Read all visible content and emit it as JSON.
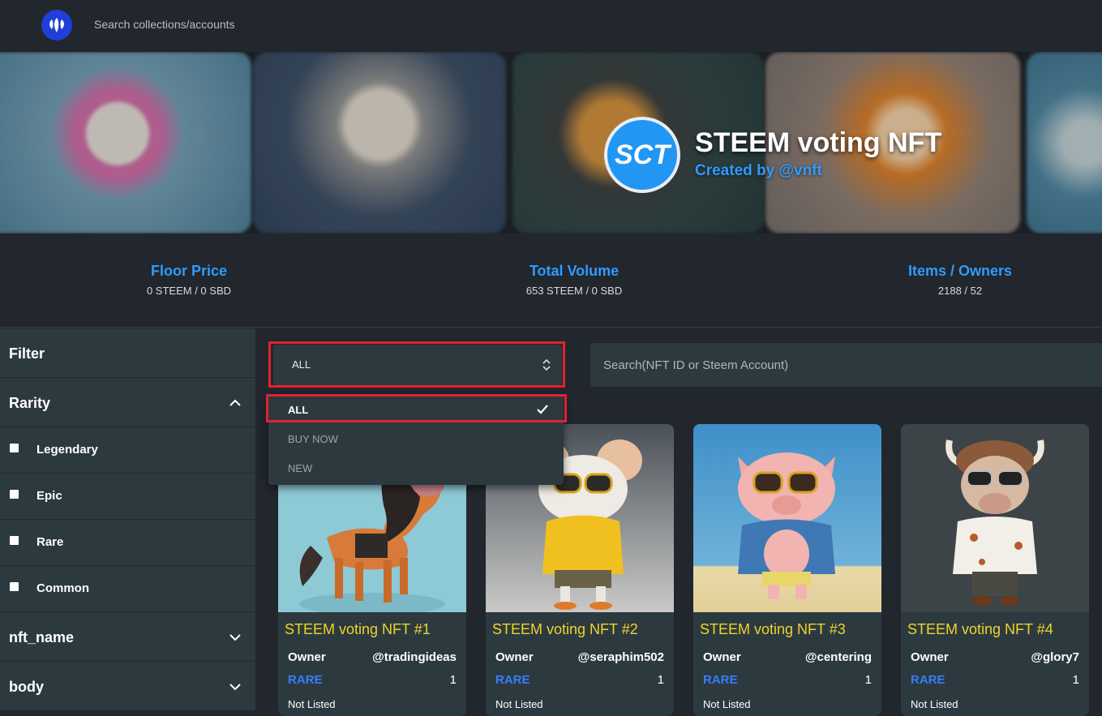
{
  "topbar": {
    "search_placeholder": "Search collections/accounts"
  },
  "collection": {
    "avatar_text": "SCT",
    "title": "STEEM voting NFT",
    "created_by": "Created by @vnft"
  },
  "stats": [
    {
      "label": "Floor Price",
      "value": "0 STEEM /  0 SBD"
    },
    {
      "label": "Total Volume",
      "value": "653 STEEM /  0 SBD"
    },
    {
      "label": "Items / Owners",
      "value": "2188 /  52"
    }
  ],
  "sidebar": {
    "filter_label": "Filter",
    "rarity_label": "Rarity",
    "rarity_options": [
      "Legendary",
      "Epic",
      "Rare",
      "Common"
    ],
    "nft_name_label": "nft_name",
    "body_label": "body"
  },
  "toolbar": {
    "select_value": "ALL",
    "search_placeholder": "Search(NFT ID or Steem Account)"
  },
  "dropdown": {
    "options": [
      "ALL",
      "BUY NOW",
      "NEW"
    ],
    "selected": "ALL"
  },
  "cards": [
    {
      "name": "STEEM voting NFT #1",
      "owner_label": "Owner",
      "owner": "@tradingideas",
      "rarity": "RARE",
      "count": "1",
      "status": "Not Listed",
      "image": "horse-with-sunglasses"
    },
    {
      "name": "STEEM voting NFT #2",
      "owner_label": "Owner",
      "owner": "@seraphim502",
      "rarity": "RARE",
      "count": "1",
      "status": "Not Listed",
      "image": "mouse-with-sunglasses"
    },
    {
      "name": "STEEM voting NFT #3",
      "owner_label": "Owner",
      "owner": "@centering",
      "rarity": "RARE",
      "count": "1",
      "status": "Not Listed",
      "image": "pig-with-sunglasses"
    },
    {
      "name": "STEEM voting NFT #4",
      "owner_label": "Owner",
      "owner": "@glory7",
      "rarity": "RARE",
      "count": "1",
      "status": "Not Listed",
      "image": "bull-with-sunglasses"
    }
  ],
  "colors": {
    "accent_blue": "#2f9bff",
    "card_title": "#f0d32a",
    "rarity": "#3a7bff",
    "highlight": "#e0232e",
    "panel": "#2c3a40",
    "background": "#22262d"
  }
}
